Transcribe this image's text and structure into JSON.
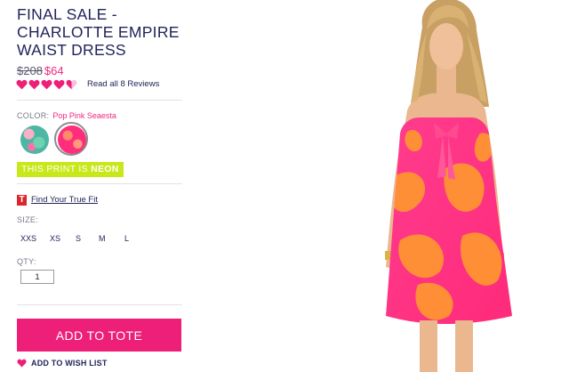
{
  "product": {
    "title": "FINAL SALE - CHARLOTTE EMPIRE WAIST DRESS",
    "original_price": "$208",
    "sale_price": "$64",
    "rating": 4.5,
    "rating_max": 5,
    "reviews_link": "Read all 8 Reviews"
  },
  "color": {
    "label": "COLOR:",
    "selected": "Pop Pink Seaesta",
    "swatches": [
      "floral-multi-swatch",
      "pop-pink-seaesta-swatch"
    ]
  },
  "badge": {
    "prefix": "THIS PRINT IS",
    "highlight": "NEON"
  },
  "fit": {
    "icon": "T",
    "link": "Find Your True Fit"
  },
  "size": {
    "label": "SIZE:",
    "options": [
      "XXS",
      "XS",
      "S",
      "M",
      "L"
    ]
  },
  "qty": {
    "label": "QTY:",
    "value": "1"
  },
  "actions": {
    "add_to_tote": "ADD TO TOTE",
    "wish_list": "ADD TO WISH LIST"
  },
  "colors": {
    "accent_pink": "#ee1f78",
    "navy_text": "#22245a",
    "neon_badge": "#c8e819"
  }
}
